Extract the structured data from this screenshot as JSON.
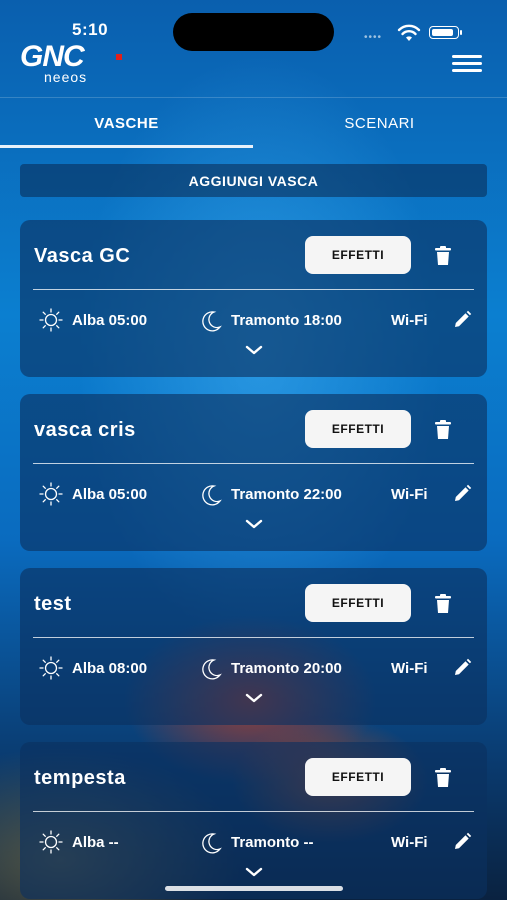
{
  "status": {
    "time": "5:10",
    "signal": "••••",
    "battery_level": 0.9
  },
  "header": {
    "logo_text": "GNC",
    "logo_subtext": "neeos"
  },
  "tabs": [
    {
      "label": "VASCHE",
      "active": true
    },
    {
      "label": "SCENARI",
      "active": false
    }
  ],
  "add_button": "AGGIUNGI VASCA",
  "tanks": [
    {
      "name": "Vasca GC",
      "effects_label": "EFFETTI",
      "sunrise": "Alba 05:00",
      "sunset": "Tramonto 18:00",
      "connection": "Wi-Fi"
    },
    {
      "name": "vasca cris",
      "effects_label": "EFFETTI",
      "sunrise": "Alba 05:00",
      "sunset": "Tramonto 22:00",
      "connection": "Wi-Fi"
    },
    {
      "name": "test",
      "effects_label": "EFFETTI",
      "sunrise": "Alba 08:00",
      "sunset": "Tramonto 20:00",
      "connection": "Wi-Fi"
    },
    {
      "name": "tempesta",
      "effects_label": "EFFETTI",
      "sunrise": "Alba --",
      "sunset": "Tramonto --",
      "connection": "Wi-Fi"
    }
  ],
  "icons": [
    "wifi-icon",
    "battery-icon",
    "menu-icon",
    "trash-icon",
    "sun-icon",
    "moon-icon",
    "edit-icon",
    "chevron-down-icon"
  ],
  "colors": {
    "accent": "#0b7fd0",
    "card_bg": "#0c3060",
    "button_bg": "#f5f5f5"
  }
}
